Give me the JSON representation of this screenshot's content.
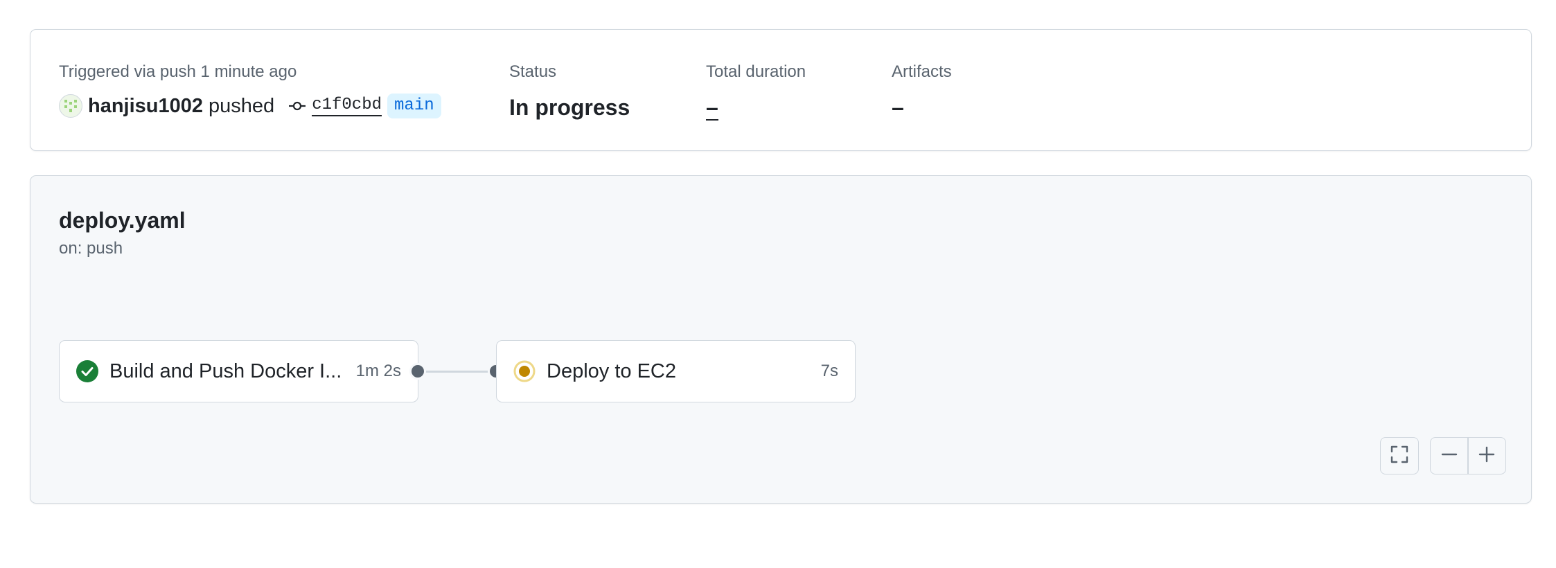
{
  "summary": {
    "trigger_label": "Triggered via push 1 minute ago",
    "user": "hanjisu1002",
    "pushed_word": "pushed",
    "commit_sha": "c1f0cbd",
    "branch": "main",
    "status_label": "Status",
    "status_value": "In progress",
    "duration_label": "Total duration",
    "duration_value": "–",
    "artifacts_label": "Artifacts",
    "artifacts_value": "–"
  },
  "workflow": {
    "file_name": "deploy.yaml",
    "trigger": "on: push",
    "jobs": [
      {
        "name": "Build and Push Docker I...",
        "duration": "1m 2s",
        "status": "success",
        "status_icon": "check-circle-fill-icon"
      },
      {
        "name": "Deploy to EC2",
        "duration": "7s",
        "status": "in_progress",
        "status_icon": "in-progress-dot-icon"
      }
    ]
  },
  "controls": {
    "fullscreen_icon": "screen-full-icon",
    "zoom_out_icon": "dash-icon",
    "zoom_in_icon": "plus-icon"
  },
  "colors": {
    "success": "#1a7f37",
    "in_progress": "#bf8700",
    "link_blue": "#0969da",
    "branch_bg": "#ddf4ff"
  }
}
